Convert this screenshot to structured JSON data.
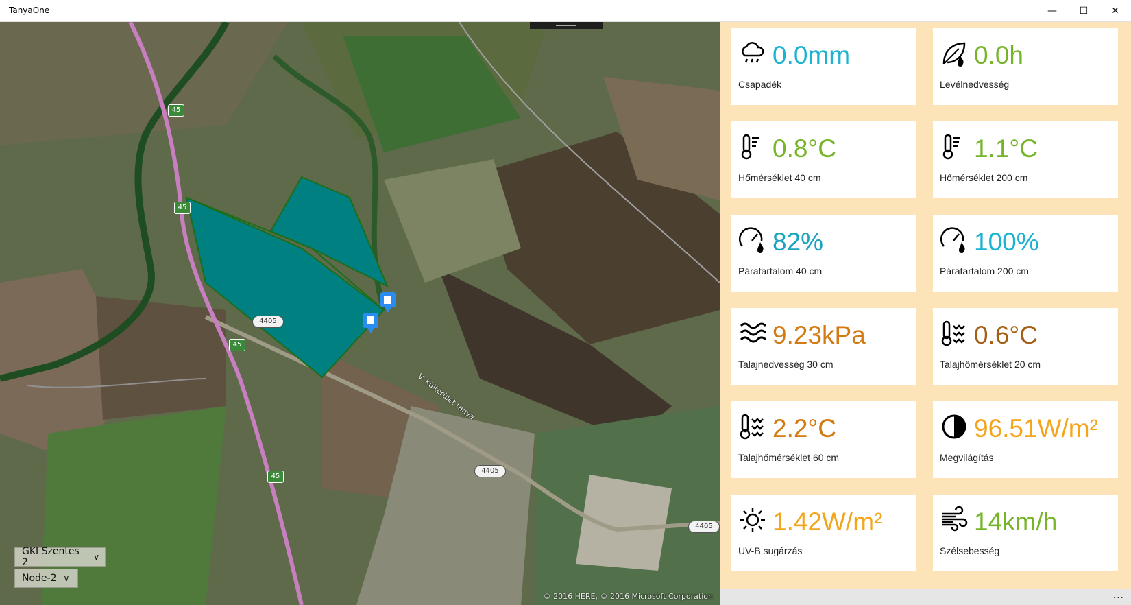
{
  "window": {
    "title": "TanyaOne",
    "minimize": "—",
    "maximize": "☐",
    "close": "✕"
  },
  "map": {
    "field_selector": "GKI Szentes 2",
    "node_selector": "Node-2",
    "copyright": "© 2016 HERE, © 2016 Microsoft Corporation",
    "road_labels": [
      "45",
      "45",
      "45",
      "45",
      "4405",
      "4405",
      "4405"
    ],
    "street_label": "V. Külterület tanya"
  },
  "colors": {
    "blue": "#1bb3d1",
    "green": "#76b52a",
    "orange": "#d37a12",
    "brown": "#a35f14",
    "amber": "#f3a51c",
    "polygon": "#008080"
  },
  "tiles": [
    {
      "icon": "rain-cloud-icon",
      "value": "0.0mm",
      "label": "Csapadék",
      "color": "#1bb3d1"
    },
    {
      "icon": "leaf-wetness-icon",
      "value": "0.0h",
      "label": "Levélnedvesség",
      "color": "#76b52a"
    },
    {
      "icon": "thermometer-icon",
      "value": "0.8°C",
      "label": "Hőmérséklet 40 cm",
      "color": "#76b52a"
    },
    {
      "icon": "thermometer-icon",
      "value": "1.1°C",
      "label": "Hőmérséklet 200 cm",
      "color": "#76b52a"
    },
    {
      "icon": "humidity-gauge-icon",
      "value": "82%",
      "label": "Páratartalom 40 cm",
      "color": "#1aa3bf"
    },
    {
      "icon": "humidity-gauge-icon",
      "value": "100%",
      "label": "Páratartalom 200 cm",
      "color": "#1bb3d1"
    },
    {
      "icon": "soil-moisture-icon",
      "value": "9.23kPa",
      "label": "Talajnedvesség 30 cm",
      "color": "#d37a12"
    },
    {
      "icon": "soil-thermometer-icon",
      "value": "0.6°C",
      "label": "Talajhőmérséklet 20 cm",
      "color": "#a35f14"
    },
    {
      "icon": "soil-thermometer-icon",
      "value": "2.2°C",
      "label": "Talajhőmérséklet 60 cm",
      "color": "#d37a12"
    },
    {
      "icon": "light-icon",
      "value": "96.51W/m²",
      "label": "Megvilágítás",
      "color": "#f3a51c"
    },
    {
      "icon": "sun-icon",
      "value": "1.42W/m²",
      "label": "UV-B sugárzás",
      "color": "#f3a51c"
    },
    {
      "icon": "wind-icon",
      "value": "14km/h",
      "label": "Szélsebesség",
      "color": "#76b52a"
    }
  ],
  "more_button": "..."
}
